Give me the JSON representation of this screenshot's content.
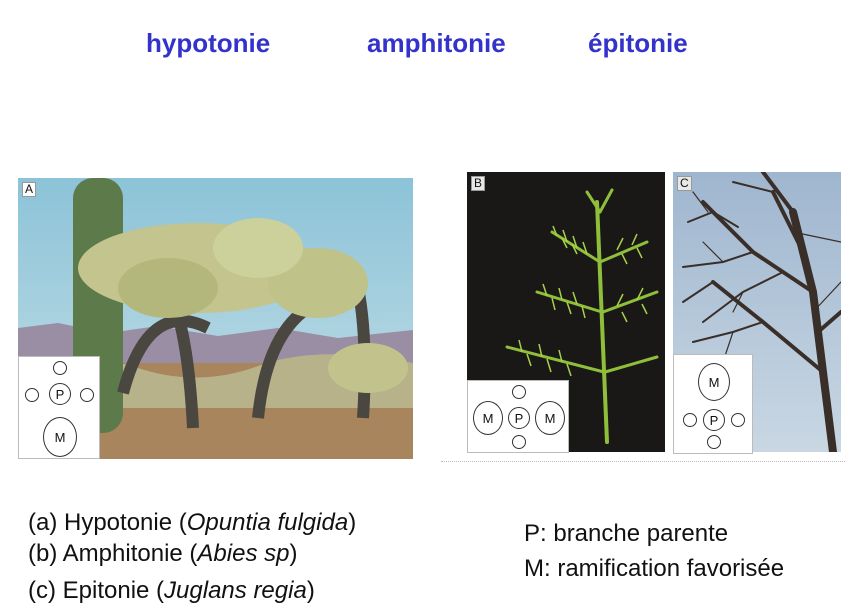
{
  "headings": [
    "hypotonie",
    "amphitonie",
    "épitonie"
  ],
  "panels": {
    "a": {
      "letter": "A",
      "P": "P",
      "M": "M"
    },
    "b": {
      "letter": "B",
      "P": "P",
      "M_left": "M",
      "M_right": "M"
    },
    "c": {
      "letter": "C",
      "P": "P",
      "M": "M"
    }
  },
  "captions": {
    "a": {
      "prefix": "(a) Hypotonie (",
      "species": "Opuntia fulgida",
      "suffix": ")"
    },
    "b": {
      "prefix": "(b) Amphitonie (",
      "species": "Abies sp",
      "suffix": ")"
    },
    "c": {
      "prefix": "(c)  Epitonie (",
      "species": "Juglans regia",
      "suffix": ")"
    }
  },
  "legend": {
    "p": "P: branche parente",
    "m": "M: ramification favorisée"
  }
}
